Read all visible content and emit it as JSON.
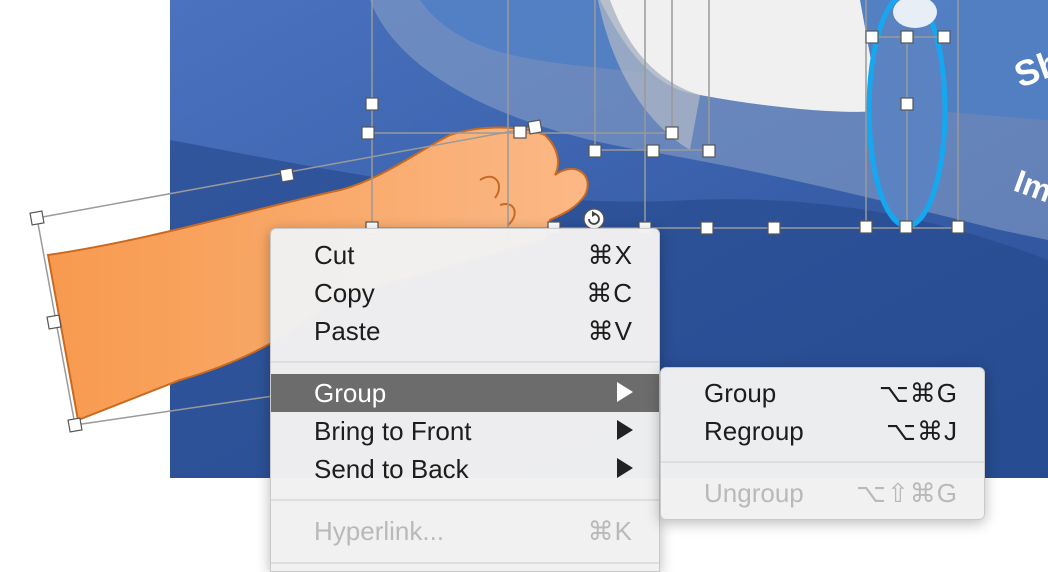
{
  "slide": {
    "background_color": "#3a64b0",
    "hand_color": "#f7a35f",
    "text_fragments": [
      "Sh",
      "Im"
    ]
  },
  "context_menu": {
    "items": [
      {
        "label": "Cut",
        "shortcut": "⌘X"
      },
      {
        "label": "Copy",
        "shortcut": "⌘C"
      },
      {
        "label": "Paste",
        "shortcut": "⌘V"
      },
      {
        "label": "Group",
        "submenu": true,
        "highlighted": true
      },
      {
        "label": "Bring to Front",
        "submenu": true
      },
      {
        "label": "Send to Back",
        "submenu": true
      },
      {
        "label": "Hyperlink...",
        "shortcut": "⌘K",
        "disabled": true
      }
    ]
  },
  "group_submenu": {
    "items": [
      {
        "label": "Group",
        "shortcut": "⌥⌘G"
      },
      {
        "label": "Regroup",
        "shortcut": "⌥⌘J"
      },
      {
        "label": "Ungroup",
        "shortcut": "⌥⇧⌘G",
        "disabled": true
      }
    ]
  },
  "colors": {
    "menu_highlight": "#6c6c6c",
    "disabled_text": "#b9b9b9",
    "selection_handle_border": "#555555"
  }
}
